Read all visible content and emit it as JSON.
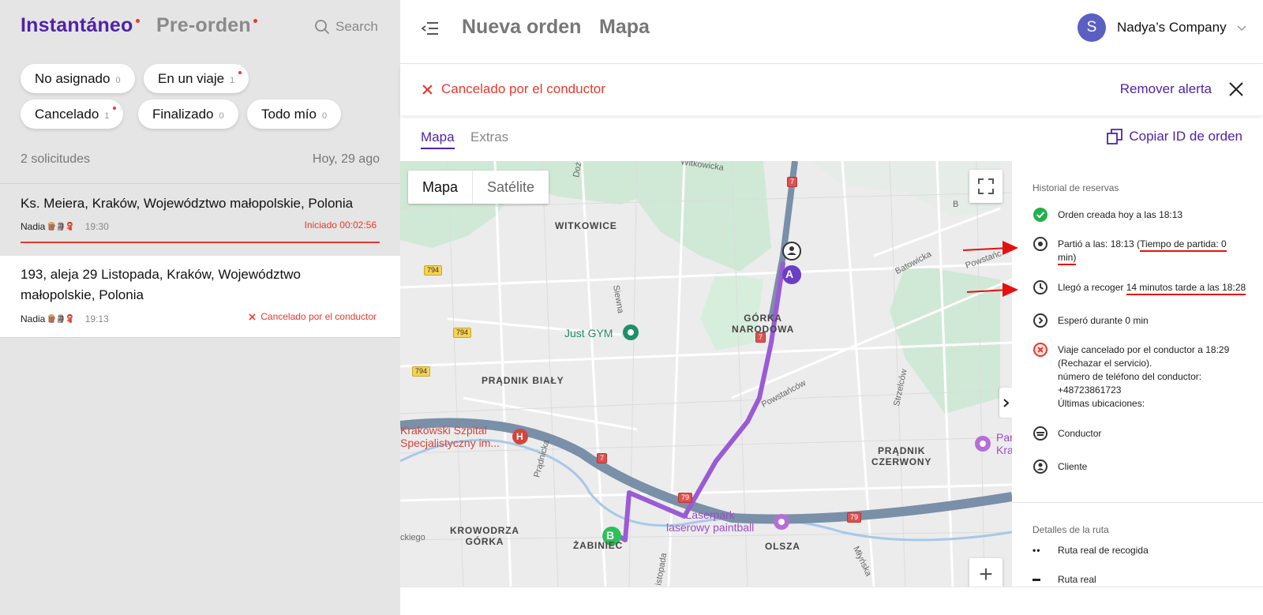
{
  "left": {
    "tabs": {
      "instant": "Instantáneo",
      "preorder": "Pre-orden"
    },
    "search_label": "Search",
    "chips": [
      {
        "label": "No asignado",
        "count": "0"
      },
      {
        "label": "En un viaje",
        "count": "1"
      },
      {
        "label": "Cancelado",
        "count": "1"
      },
      {
        "label": "Finalizado",
        "count": "0"
      },
      {
        "label": "Todo mío",
        "count": "0"
      }
    ],
    "requests_count": "2 solicitudes",
    "date": "Hoy, 29 ago",
    "orders": [
      {
        "address": "Ks. Meiera, Kraków, Województwo małopolskie, Polonia",
        "driver": "Nadia",
        "flags": "🪵🗿🧣",
        "time": "19:30",
        "status": "Iniciado 00:02:56",
        "progress": 1.0
      },
      {
        "address": "193, aleja 29 Listopada, Kraków, Województwo małopolskie, Polonia",
        "driver": "Nadia",
        "flags": "🪵🗿🧣",
        "time": "19:13",
        "status": "Cancelado por el conductor"
      }
    ]
  },
  "header": {
    "title_new_order": "Nueva orden",
    "title_map": "Mapa",
    "avatar_letter": "S",
    "company": "Nadya’s Company"
  },
  "alert": {
    "text": "Cancelado por el conductor",
    "remove": "Remover alerta"
  },
  "tabs": {
    "map": "Mapa",
    "extras": "Extras",
    "copy_id": "Copiar ID de orden"
  },
  "map": {
    "toggle_map": "Mapa",
    "toggle_satellite": "Satélite",
    "zoom_in": "+",
    "labels": {
      "witkowice": "WITKOWICE",
      "gorka": "GÓRKA\nNARODOWA",
      "pradnik_bialy": "PRĄDNIK BIAŁY",
      "pradnik_czerwony": "PRĄDNIK\nCZERWONY",
      "krowodrza": "KROWODRZA\nGÓRKA",
      "zabiniec": "ŻABINIEC",
      "olsza": "OLSZA",
      "just_gym": "Just GYM",
      "hospital": "Krakowski Szpital\nSpecjalistyczny im...",
      "laserpark": "Laserpark\nlaserowy paintball",
      "par": "Par\nKra",
      "witkowicka": "Witkowicka",
      "siewna": "Siewna",
      "pradnicka": "Prądnicka",
      "powstancow": "Powstańców",
      "batowicka": "Batowicka",
      "strzelcow": "Strzelców",
      "mlynska": "Młyńska",
      "kiego": "ckiego",
      "istopada": "istopada",
      "powstanc2": "Powstańc",
      "b": "B",
      "doz": "Doż",
      "s794a": "794",
      "s794b": "794",
      "s794c": "794",
      "s7a": "7",
      "s7b": "7",
      "s7c": "7",
      "s79a": "79",
      "s79b": "79",
      "marker_a": "A",
      "marker_b": "B",
      "hospital_h": "H"
    }
  },
  "history": {
    "title": "Historial de reservas",
    "items": [
      {
        "icon": "check-circle-icon",
        "text": "Orden creada hoy a las 18:13"
      },
      {
        "icon": "target-icon",
        "text_a": "Partió a las: 18:13 (",
        "text_b": "Tiempo de partida: 0",
        "text_c": "min)"
      },
      {
        "icon": "clock-icon",
        "text_a": "Llegó a recoger ",
        "text_b": "14 minutos tarde a las 18:28"
      },
      {
        "icon": "chevron-circle-icon",
        "text": "Esperó durante 0 min"
      },
      {
        "icon": "cancel-circle-icon",
        "lines": [
          "Viaje cancelado por el conductor a 18:29",
          "(Rechazar el servicio).",
          "número de teléfono del conductor:",
          "+48723861723",
          "Últimas ubicaciones:"
        ]
      },
      {
        "icon": "driver-icon",
        "text": "Conductor"
      },
      {
        "icon": "client-icon",
        "text": "Cliente"
      }
    ],
    "route_title": "Detalles de la ruta",
    "route_items": [
      "Ruta real de recogida",
      "Ruta real"
    ]
  },
  "colors": {
    "accent": "#4f23a9",
    "danger": "#e8392e",
    "route": "#9b5bd4"
  }
}
